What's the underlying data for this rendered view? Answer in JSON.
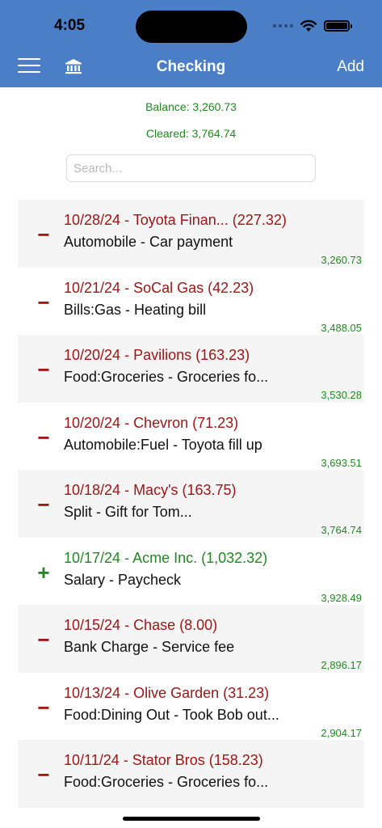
{
  "status": {
    "time": "4:05"
  },
  "nav": {
    "title": "Checking",
    "add_label": "Add"
  },
  "summary": {
    "balance": "Balance: 3,260.73",
    "cleared": "Cleared: 3,764.74"
  },
  "search": {
    "placeholder": "Search...",
    "value": ""
  },
  "transactions": [
    {
      "sign": "−",
      "type": "debit",
      "line1": "10/28/24 - Toyota Finan... (227.32)",
      "line2": "Automobile - Car payment",
      "running_balance": "3,260.73"
    },
    {
      "sign": "−",
      "type": "debit",
      "line1": "10/21/24 - SoCal Gas (42.23)",
      "line2": "Bills:Gas - Heating bill",
      "running_balance": "3,488.05"
    },
    {
      "sign": "−",
      "type": "debit",
      "line1": "10/20/24 - Pavilions (163.23)",
      "line2": "Food:Groceries - Groceries fo...",
      "running_balance": "3,530.28"
    },
    {
      "sign": "−",
      "type": "debit",
      "line1": "10/20/24 - Chevron (71.23)",
      "line2": "Automobile:Fuel - Toyota fill up",
      "running_balance": "3,693.51"
    },
    {
      "sign": "−",
      "type": "debit",
      "line1": "10/18/24 - Macy's (163.75)",
      "line2": "Split - Gift for Tom...",
      "running_balance": "3,764.74"
    },
    {
      "sign": "+",
      "type": "credit",
      "line1": "10/17/24 - Acme Inc. (1,032.32)",
      "line2": "Salary - Paycheck",
      "running_balance": "3,928.49"
    },
    {
      "sign": "−",
      "type": "debit",
      "line1": "10/15/24 - Chase (8.00)",
      "line2": "Bank Charge - Service fee",
      "running_balance": "2,896.17"
    },
    {
      "sign": "−",
      "type": "debit",
      "line1": "10/13/24 - Olive Garden (31.23)",
      "line2": "Food:Dining Out - Took Bob out...",
      "running_balance": "2,904.17"
    },
    {
      "sign": "−",
      "type": "debit",
      "line1": "10/11/24 - Stator Bros (158.23)",
      "line2": "Food:Groceries - Groceries fo...",
      "running_balance": ""
    }
  ],
  "colors": {
    "header": "#4a7ec7",
    "debit": "#a31515",
    "credit": "#1f8a1f",
    "row_shade": "#f5f5f5"
  },
  "icons": {
    "menu": "hamburger-icon",
    "account": "bank-icon",
    "wifi": "wifi-icon",
    "battery": "battery-icon"
  }
}
